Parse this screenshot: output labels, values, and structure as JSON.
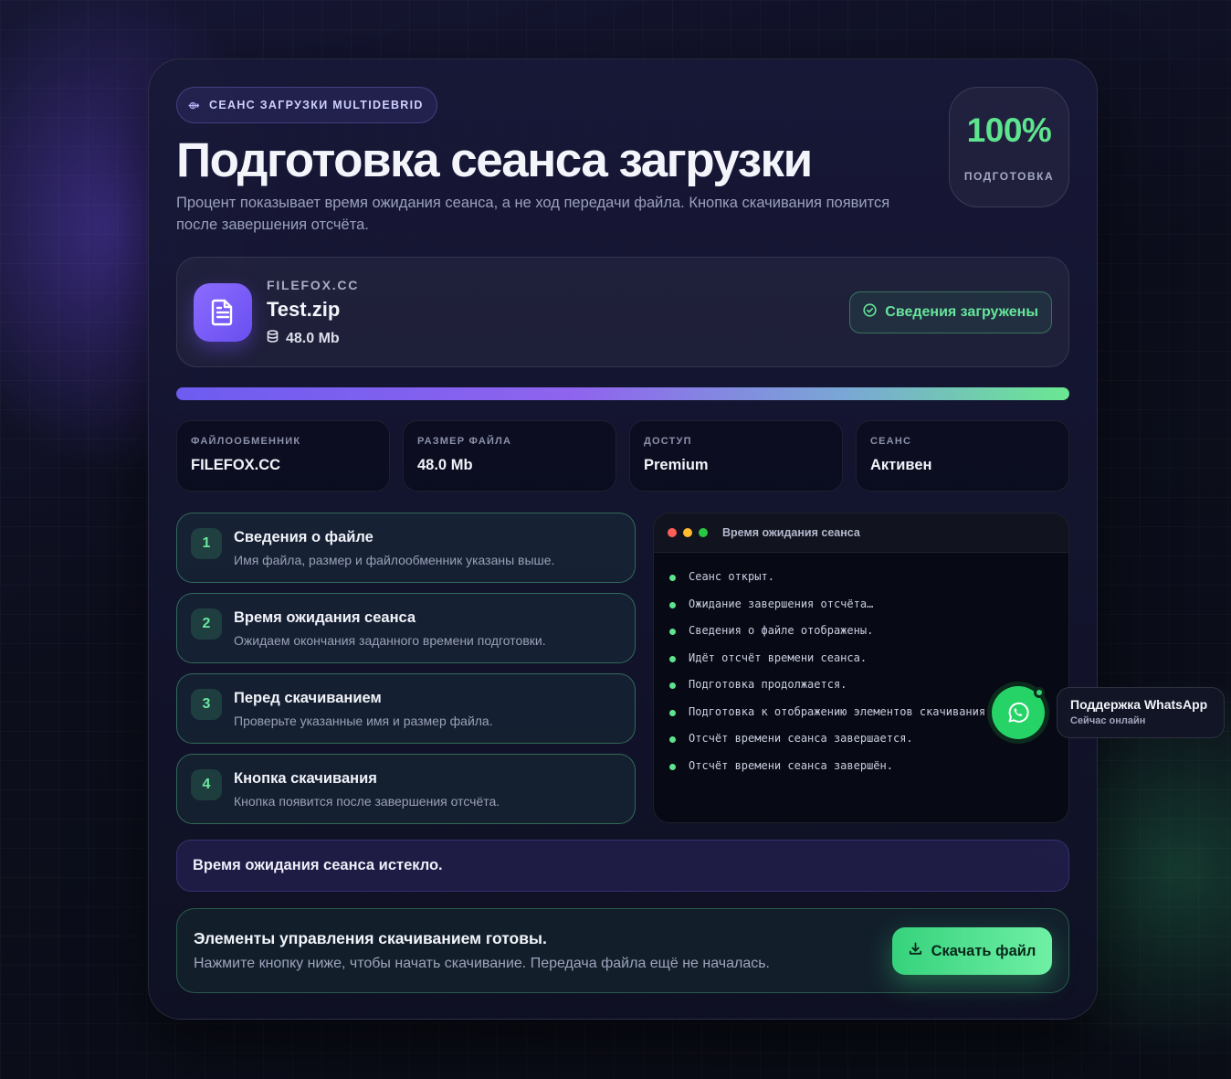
{
  "header": {
    "badge_icon": "session-icon",
    "badge": "СЕАНС ЗАГРУЗКИ MULTIDEBRID",
    "title": "Подготовка сеанса загрузки",
    "subtitle": "Процент показывает время ожидания сеанса, а не ход передачи файла. Кнопка скачивания появится после завершения отсчёта.",
    "percent": "100%",
    "percent_label": "ПОДГОТОВКА"
  },
  "file": {
    "icon": "document-icon",
    "host": "FILEFOX.CC",
    "name": "Test.zip",
    "size": "48.0 Mb",
    "status": "Сведения загружены"
  },
  "progress": {
    "value": 1.0
  },
  "info": [
    {
      "label": "ФАЙЛООБМЕННИК",
      "value": "FILEFOX.CC"
    },
    {
      "label": "РАЗМЕР ФАЙЛА",
      "value": "48.0 Mb"
    },
    {
      "label": "ДОСТУП",
      "value": "Premium"
    },
    {
      "label": "СЕАНС",
      "value": "Активен"
    }
  ],
  "steps": [
    {
      "num": "1",
      "title": "Сведения о файле",
      "desc": "Имя файла, размер и файлообменник указаны выше."
    },
    {
      "num": "2",
      "title": "Время ожидания сеанса",
      "desc": "Ожидаем окончания заданного времени подготовки."
    },
    {
      "num": "3",
      "title": "Перед скачиванием",
      "desc": "Проверьте указанные имя и размер файла."
    },
    {
      "num": "4",
      "title": "Кнопка скачивания",
      "desc": "Кнопка появится после завершения отсчёта."
    }
  ],
  "terminal": {
    "title": "Время ожидания сеанса",
    "dot_colors": [
      "#ff5f57",
      "#febc2e",
      "#28c840"
    ],
    "lines": [
      "Сеанс открыт.",
      "Ожидание завершения отсчёта…",
      "Сведения о файле отображены.",
      "Идёт отсчёт времени сеанса.",
      "Подготовка продолжается.",
      "Подготовка к отображению элементов скачивания.",
      "Отсчёт времени сеанса завершается.",
      "Отсчёт времени сеанса завершён."
    ]
  },
  "notice": "Время ожидания сеанса истекло.",
  "ready": {
    "title": "Элементы управления скачиванием готовы.",
    "desc": "Нажмите кнопку ниже, чтобы начать скачивание. Передача файла ещё не началась.",
    "button": "Скачать файл"
  },
  "support": {
    "title": "Поддержка WhatsApp",
    "status": "Сейчас онлайн"
  },
  "colors": {
    "accent_green": "#5ee38f",
    "accent_purple": "#7a5cf5",
    "whatsapp": "#25d366"
  }
}
